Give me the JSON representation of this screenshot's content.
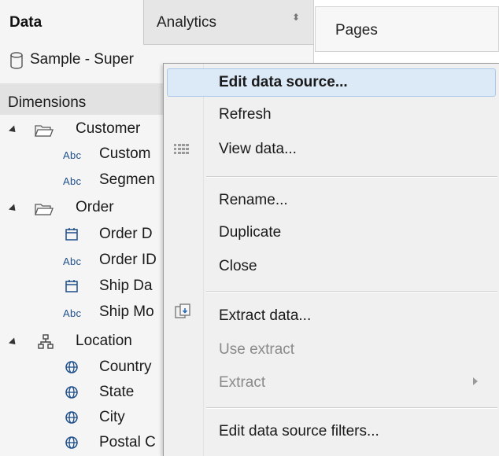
{
  "tabs": {
    "data_label": "Data",
    "analytics_label": "Analytics",
    "analytics_arrows": "⬍"
  },
  "datasource": {
    "name": "Sample - Super",
    "icon": "database-cylinder-icon"
  },
  "dimensions": {
    "label": "Dimensions"
  },
  "tree": {
    "customer_folder": "Customer",
    "customer_name": "Custom",
    "segment": "Segmen",
    "order_folder": "Order",
    "order_date": "Order D",
    "order_id": "Order ID",
    "ship_date": "Ship Da",
    "ship_mode": "Ship Mo",
    "location_folder": "Location",
    "country": "Country",
    "state": "State",
    "city": "City",
    "postal_code": "Postal C",
    "abc": "Abc"
  },
  "pages": {
    "label": "Pages"
  },
  "menu": {
    "edit_data_source": "Edit data source...",
    "refresh": "Refresh",
    "view_data": "View data...",
    "rename": "Rename...",
    "duplicate": "Duplicate",
    "close": "Close",
    "extract_data": "Extract data...",
    "use_extract": "Use extract",
    "extract": "Extract",
    "edit_filters": "Edit data source filters..."
  },
  "colors": {
    "menu_bg": "#f0f0f0",
    "highlight": "#dce9f7",
    "disabled_text": "#8a8a8a",
    "abc_blue": "#1f4f8c"
  }
}
